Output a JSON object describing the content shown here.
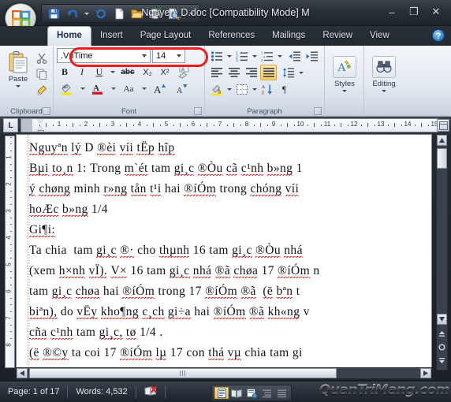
{
  "window": {
    "title": "Nguyen_D.doc [Compatibility Mode] M",
    "minimize_label": "–",
    "maximize_label": "❐",
    "close_label": "✕",
    "office_button": "office-orb"
  },
  "qat": {
    "items": [
      {
        "name": "save-icon",
        "label": "Save"
      },
      {
        "name": "undo-icon",
        "label": "Undo"
      },
      {
        "name": "redo-icon",
        "label": "Redo"
      },
      {
        "name": "new-document-icon",
        "label": "New"
      },
      {
        "name": "open-folder-icon",
        "label": "Open"
      },
      {
        "name": "quick-print-icon",
        "label": "Quick Print"
      },
      {
        "name": "print-preview-icon",
        "label": "Print Preview"
      }
    ],
    "customize_label": "Customize Quick Access Toolbar"
  },
  "ribbon": {
    "tabs": [
      {
        "label": "Home",
        "active": true
      },
      {
        "label": "Insert",
        "active": false
      },
      {
        "label": "Page Layout",
        "active": false
      },
      {
        "label": "References",
        "active": false
      },
      {
        "label": "Mailings",
        "active": false
      },
      {
        "label": "Review",
        "active": false
      },
      {
        "label": "View",
        "active": false
      }
    ],
    "help_label": "?",
    "groups": {
      "clipboard": {
        "label": "Clipboard",
        "paste_label": "Paste",
        "cut_label": "Cut",
        "copy_label": "Copy",
        "format_painter_label": "Format Painter"
      },
      "font": {
        "label": "Font",
        "font_name_value": ".VnTime",
        "font_size_value": "14",
        "bold_label": "B",
        "italic_label": "I",
        "underline_label": "U",
        "strikethrough_label": "abc",
        "subscript_label": "X₂",
        "superscript_label": "X²",
        "clear_formatting_label": "Clear Formatting",
        "highlight_label": "Text Highlight Color",
        "font_color_label": "Font Color",
        "change_case_label": "Aa",
        "grow_font_label": "A",
        "shrink_font_label": "A"
      },
      "paragraph": {
        "label": "Paragraph",
        "bullets_label": "Bullets",
        "numbering_label": "Numbering",
        "multilevel_label": "Multilevel List",
        "decrease_indent_label": "Decrease Indent",
        "increase_indent_label": "Increase Indent",
        "align_left_label": "Align Left",
        "center_label": "Center",
        "align_right_label": "Align Right",
        "justify_label": "Justify",
        "line_spacing_label": "Line Spacing",
        "shading_label": "Shading",
        "borders_label": "Borders",
        "sort_label": "Sort",
        "show_marks_label": "¶"
      },
      "styles": {
        "label": "Styles"
      },
      "editing": {
        "label": "Editing"
      }
    }
  },
  "ruler": {
    "tab_selector_label": "L",
    "h_numbers": [
      "1",
      "2",
      "3",
      "4",
      "5",
      "6",
      "7",
      "8",
      "9",
      "10",
      "11",
      "12",
      "13",
      "14",
      "15"
    ],
    "v_numbers": [
      "1",
      "2",
      "3",
      "4",
      "5",
      "6",
      "7",
      "8"
    ]
  },
  "document": {
    "lines": [
      "Nguyªn lý D ®èi víi tËp hîp",
      "Bµi to¸n 1: Trong m`ét tam gi¸c ®Òu cã c¹nh b»ng 1 ",
      "ý chøng minh r»ng tån t¹i hai ®íÓm trong chóng víi",
      "hoÆc b»ng 1/4",
      "Gi¶i:",
      "Ta chia  tam gi¸c ®· cho thµnh 16 tam gi¸c ®Òu nhá ",
      "(xem h×nh vÏ). V× 16 tam gi¸c nhá ®ã chøa 17 ®íÓm n",
      "tam gi¸c chøa hai ®íÓm trong 17 ®íÓm ®ã  (ë bªn t",
      "biªn), do vËy kho¶ng c¸ch gi÷a hai ®íÓm ®ã kh«ng v",
      "cña c¹nh tam gi¸c, tø 1/4 .",
      "(ë ®©y ta coi 17 ®íÓm lµ 17 con thá vµ chia tam gi"
    ]
  },
  "status": {
    "page_label": "Page: 1 of 17",
    "words_label": "Words: 4,532",
    "spellcheck_label": "Proofing Errors",
    "views": [
      {
        "name": "print-layout-view",
        "active": true
      },
      {
        "name": "full-screen-reading-view",
        "active": false
      },
      {
        "name": "web-layout-view",
        "active": false
      },
      {
        "name": "outline-view",
        "active": false
      },
      {
        "name": "draft-view",
        "active": false
      }
    ],
    "watermark": "QuanTriMang.com"
  },
  "scrollbars": {
    "up_label": "▲",
    "down_label": "▼",
    "left_label": "◀",
    "right_label": "▶",
    "previous_page_label": "⤒",
    "select_browse_object_label": "○",
    "next_page_label": "⤓"
  },
  "annotation": {
    "shape": "red-ellipse-highlight",
    "target": "font-name-box"
  },
  "colors": {
    "accent_red": "#ee1c20",
    "ribbon_bg": "#e4eaf1",
    "titlebar_dark": "#2a3038",
    "active_tab": "#f3f7fb"
  }
}
